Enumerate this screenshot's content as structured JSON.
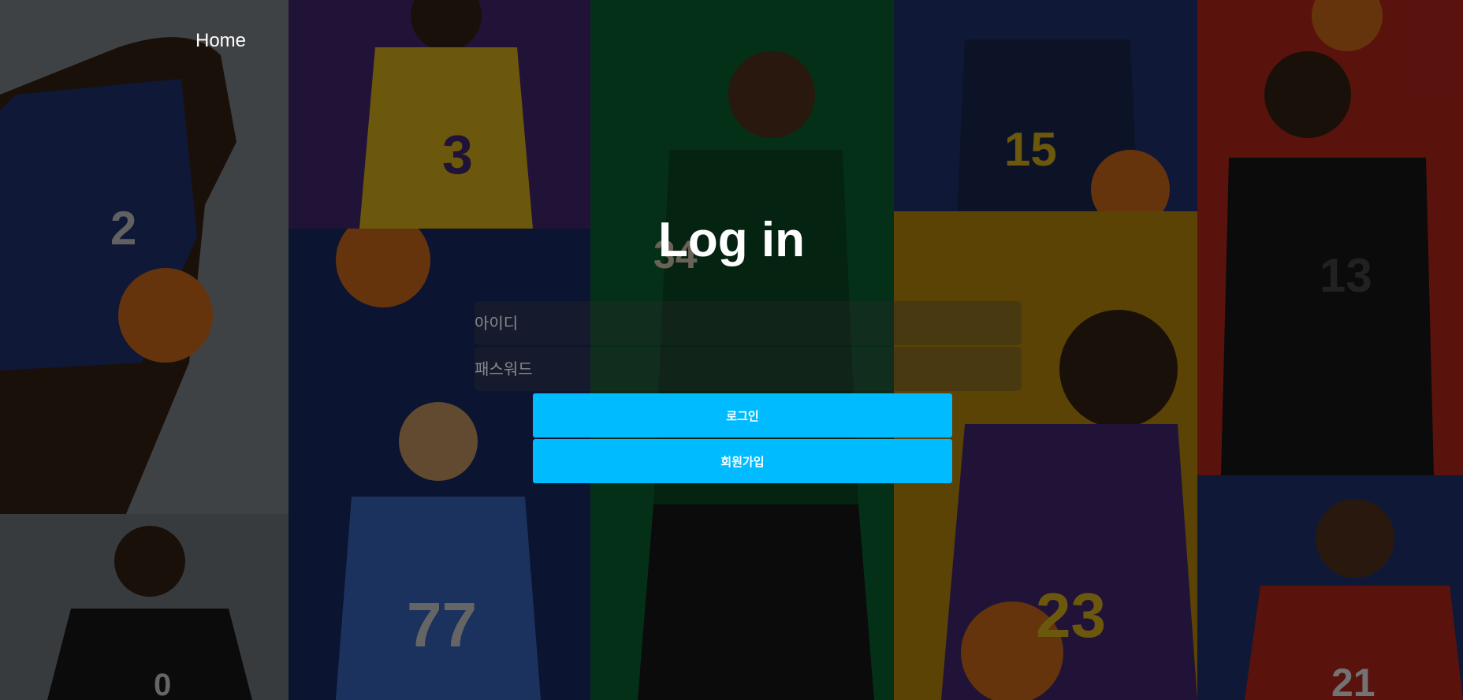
{
  "nav": {
    "home_label": "Home"
  },
  "login": {
    "title": "Log in",
    "id_placeholder": "아이디",
    "password_placeholder": "패스워드",
    "login_button": "로그인",
    "signup_button": "회원가입"
  },
  "jerseys": {
    "p1": "2",
    "p2": "3",
    "p3": "34",
    "p4": "15",
    "p5": "13",
    "p6": "0",
    "p7": "77",
    "p8": "23",
    "p9": "21"
  },
  "colors": {
    "accent": "#00bbff",
    "panel_gray": "#8c9299",
    "panel_purple": "#4a2a7a",
    "panel_green": "#0a6b35",
    "panel_navy": "#1e3370",
    "panel_red": "#c8281e",
    "panel_yellow": "#c9960e"
  }
}
